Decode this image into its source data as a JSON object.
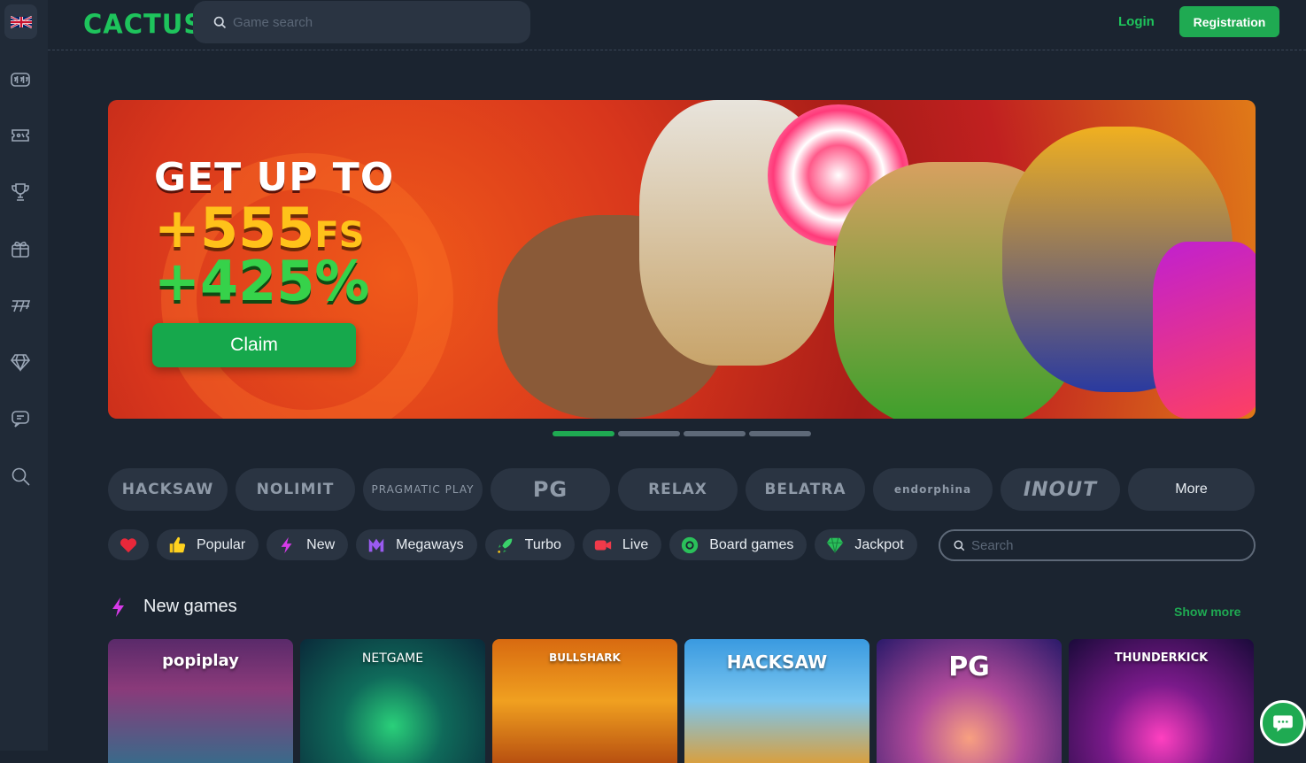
{
  "header": {
    "logo": "CACTUS",
    "search_placeholder": "Game search",
    "login": "Login",
    "register": "Registration"
  },
  "sidebar": {
    "items": [
      "slots-icon",
      "tickets-icon",
      "trophy-icon",
      "gift-icon",
      "sevens-icon",
      "diamond-icon",
      "chat-icon",
      "search-icon"
    ]
  },
  "banner": {
    "headline": "GET UP TO",
    "fs_value": "+555",
    "fs_suffix": "FS",
    "pct": "+425%",
    "cta": "Claim",
    "slides": 4,
    "active_slide": 1
  },
  "providers": [
    "HACKSAW",
    "NOLIMIT",
    "PRAGMATIC PLAY",
    "PG",
    "RELAX",
    "BELATRA",
    "endorphina",
    "INOUT"
  ],
  "providers_more": "More",
  "categories": {
    "popular": "Popular",
    "new": "New",
    "megaways": "Megaways",
    "turbo": "Turbo",
    "live": "Live",
    "board": "Board games",
    "jackpot": "Jackpot",
    "search_placeholder": "Search"
  },
  "section": {
    "title": "New games",
    "show_more": "Show more"
  },
  "games": [
    "popiplay",
    "NETGAME",
    "BULLSHARK",
    "HACKSAW",
    "PG",
    "THUNDERKICK"
  ],
  "colors": {
    "accent": "#1faa52",
    "background": "#1b2430",
    "panel": "#2a3442"
  }
}
